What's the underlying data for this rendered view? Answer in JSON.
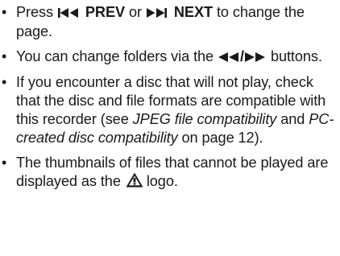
{
  "items": [
    {
      "press": "Press",
      "prev_label": "PREV",
      "or": "or",
      "next_label": "NEXT",
      "rest": "to change the page.",
      "prev_icon": "skip-previous-icon",
      "next_icon": "skip-next-icon"
    },
    {
      "before": "You can change folders via the",
      "slash": "/",
      "after": "buttons.",
      "rewind_icon": "rewind-icon",
      "forward_icon": "fast-forward-icon"
    },
    {
      "text_a": "If you encounter a disc that will not play, check that the disc and file formats are compatible with this recorder (see",
      "ref1": "JPEG file compatibility",
      "and": "and",
      "ref2": "PC-created disc compatibility",
      "text_b": "on page 12)."
    },
    {
      "before": "The thumbnails of files that cannot be played are displayed as the",
      "after": "logo.",
      "logo_icon": "warning-triangle-icon"
    }
  ]
}
